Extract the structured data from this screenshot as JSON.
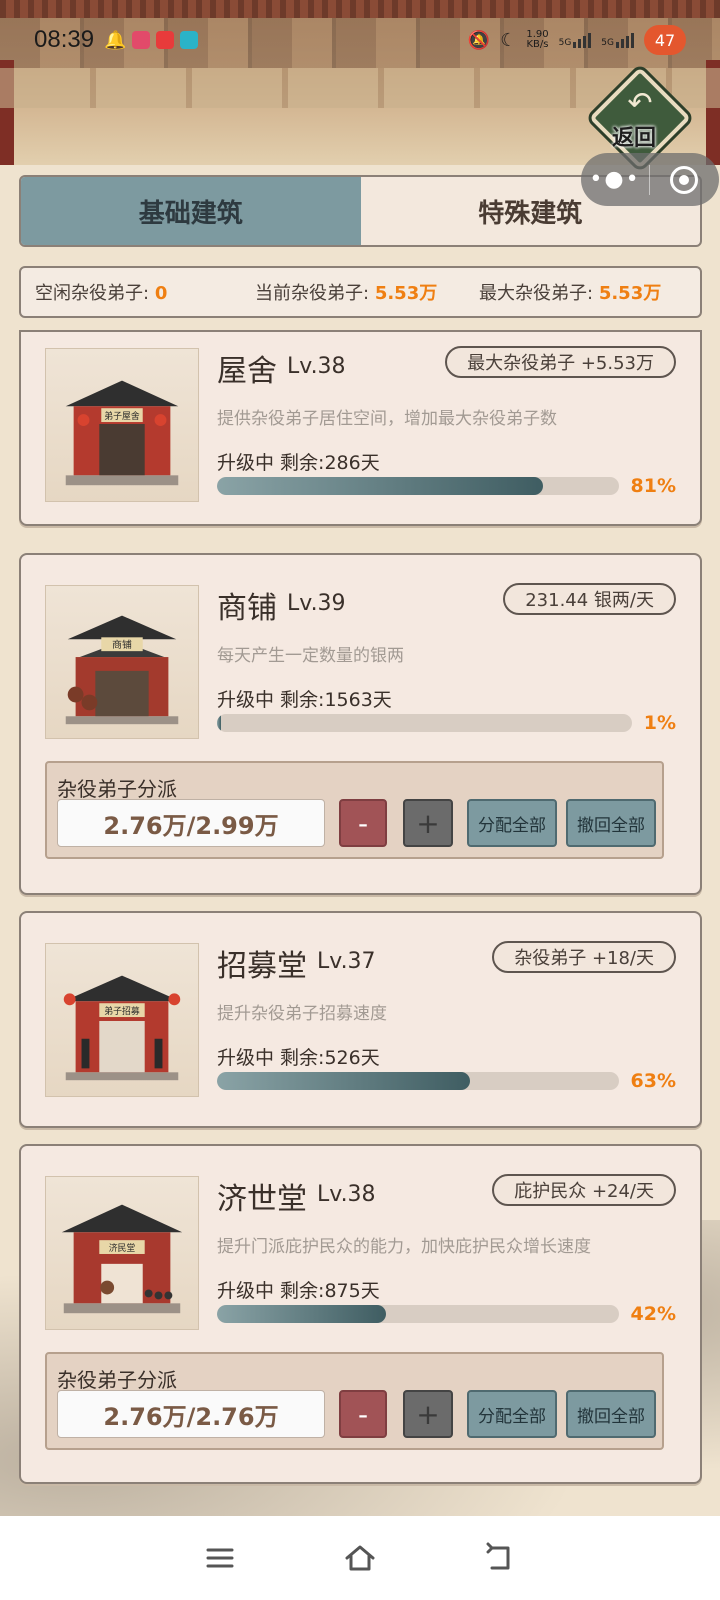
{
  "status_bar": {
    "time": "08:39",
    "net_speed_value": "1.90",
    "net_speed_unit": "KB/s",
    "signal1": "5G",
    "signal2": "5G",
    "battery": "47"
  },
  "header": {
    "back_label": "返回"
  },
  "tabs": [
    {
      "label": "基础建筑",
      "active": true
    },
    {
      "label": "特殊建筑",
      "active": false
    }
  ],
  "stats": {
    "idle_label": "空闲杂役弟子:",
    "idle_value": "0",
    "current_label": "当前杂役弟子:",
    "current_value": "5.53万",
    "max_label": "最大杂役弟子:",
    "max_value": "5.53万"
  },
  "buildings": [
    {
      "name": "屋舍",
      "level": "Lv.38",
      "badge": "最大杂役弟子 +5.53万",
      "desc": "提供杂役弟子居住空间，增加最大杂役弟子数",
      "status": "升级中  剩余:286天",
      "progress": 0.81,
      "pct": "81%",
      "sign": "弟子屋舍"
    },
    {
      "name": "商铺",
      "level": "Lv.39",
      "badge": "231.44 银两/天",
      "desc": "每天产生一定数量的银两",
      "status": "升级中  剩余:1563天",
      "progress": 0.01,
      "pct": "1%",
      "sign": "商铺",
      "assign_title": "杂役弟子分派",
      "assign_count": "2.76万/2.99万"
    },
    {
      "name": "招募堂",
      "level": "Lv.37",
      "badge": "杂役弟子 +18/天",
      "desc": "提升杂役弟子招募速度",
      "status": "升级中  剩余:526天",
      "progress": 0.63,
      "pct": "63%",
      "sign": "弟子招募"
    },
    {
      "name": "济世堂",
      "level": "Lv.38",
      "badge": "庇护民众 +24/天",
      "desc": "提升门派庇护民众的能力，加快庇护民众增长速度",
      "status": "升级中  剩余:875天",
      "progress": 0.42,
      "pct": "42%",
      "sign": "济民堂",
      "assign_title": "杂役弟子分派",
      "assign_count": "2.76万/2.76万"
    }
  ],
  "assign_buttons": {
    "minus": "-",
    "plus": "+",
    "alloc": "分配全部",
    "recall": "撤回全部"
  },
  "colors": {
    "accent_orange": "#ef7f12",
    "tab_active": "#7d9aa0",
    "minus_red": "#a15356"
  }
}
